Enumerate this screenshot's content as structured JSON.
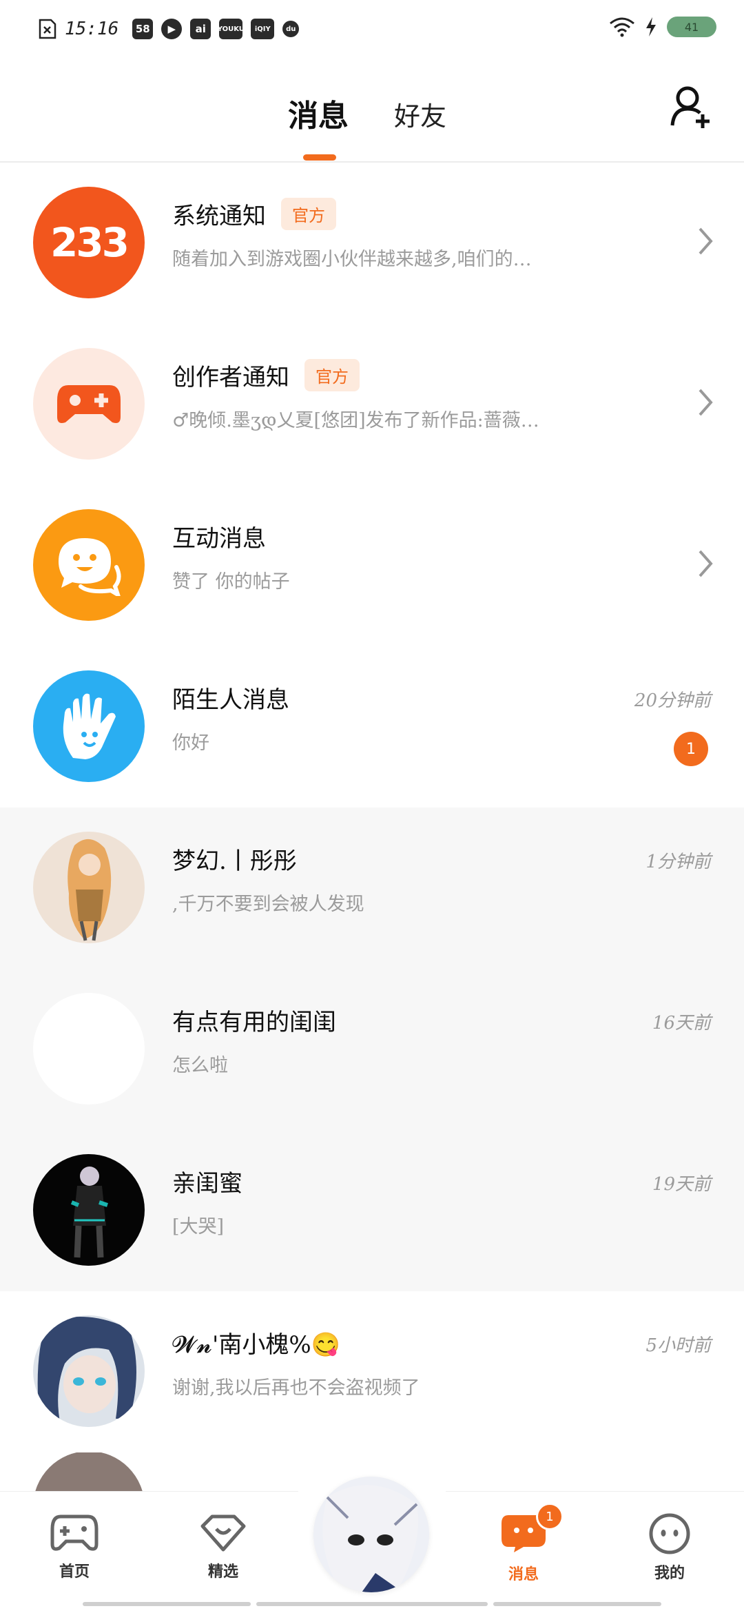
{
  "status_bar": {
    "time": "15:16",
    "app_icons": [
      "58",
      "▶",
      "ai",
      "YOUKU",
      "iQIY",
      "du"
    ],
    "battery_text": "41"
  },
  "header": {
    "tabs": [
      {
        "label": "消息",
        "active": true
      },
      {
        "label": "好友",
        "active": false
      }
    ],
    "add_friend_icon": "add-user-icon"
  },
  "accent_color": "#f26b1d",
  "conversations": [
    {
      "title": "系统通知",
      "tag": "官方",
      "preview": "随着加入到游戏圈小伙伴越来越多,咱们的…",
      "time": "",
      "unread": "",
      "has_chevron": true,
      "avatar": "233-logo"
    },
    {
      "title": "创作者通知",
      "tag": "官方",
      "preview": "♂晚倾.墨ʒდ乂夏[悠团]发布了新作品:蔷薇…",
      "time": "",
      "unread": "",
      "has_chevron": true,
      "avatar": "gamepad-plus-icon"
    },
    {
      "title": "互动消息",
      "tag": "",
      "preview": "赞了 你的帖子",
      "time": "",
      "unread": "",
      "has_chevron": true,
      "avatar": "chat-smile-icon"
    },
    {
      "title": "陌生人消息",
      "tag": "",
      "preview": "你好",
      "time": "20分钟前",
      "unread": "1",
      "has_chevron": false,
      "avatar": "wave-hand-icon"
    },
    {
      "title": "梦幻.丨彤彤",
      "tag": "",
      "preview": ",千万不要到会被人发现",
      "time": "1分钟前",
      "unread": "",
      "has_chevron": false,
      "avatar": "user-avatar"
    },
    {
      "title": "有点有用的闺闺",
      "tag": "",
      "preview": "怎么啦",
      "time": "16天前",
      "unread": "",
      "has_chevron": false,
      "avatar": "user-avatar"
    },
    {
      "title": "亲闺蜜",
      "tag": "",
      "preview": "[大哭]",
      "time": "19天前",
      "unread": "",
      "has_chevron": false,
      "avatar": "user-avatar"
    },
    {
      "title": "𝓦𝓷'南小槐%😋",
      "tag": "",
      "preview": "谢谢,我以后再也不会盗视频了",
      "time": "5小时前",
      "unread": "",
      "has_chevron": false,
      "avatar": "user-avatar"
    }
  ],
  "bottom_nav": {
    "items": [
      {
        "label": "首页",
        "icon": "gamepad-icon",
        "active": false
      },
      {
        "label": "精选",
        "icon": "heart-diamond-icon",
        "active": false
      },
      {
        "label": "",
        "icon": "center-avatar",
        "active": false
      },
      {
        "label": "消息",
        "icon": "message-icon",
        "active": true,
        "badge": "1"
      },
      {
        "label": "我的",
        "icon": "profile-face-icon",
        "active": false
      }
    ]
  }
}
